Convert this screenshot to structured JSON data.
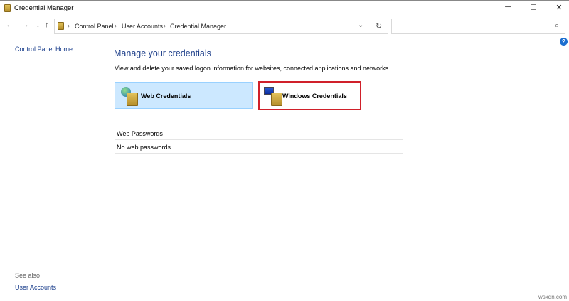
{
  "window": {
    "title": "Credential Manager",
    "minimize": "─",
    "maximize": "☐",
    "close": "✕"
  },
  "nav": {
    "back": "←",
    "forward": "→",
    "recent": "⌄",
    "up": "↑",
    "refresh": "↻",
    "dropdown": "⌄",
    "search_icon": "⌕"
  },
  "breadcrumb": [
    "Control Panel",
    "User Accounts",
    "Credential Manager"
  ],
  "search": {
    "placeholder": ""
  },
  "sidebar": {
    "home": "Control Panel Home",
    "see_also": "See also",
    "user_accounts": "User Accounts"
  },
  "main": {
    "title": "Manage your credentials",
    "description": "View and delete your saved logon information for websites, connected applications and networks.",
    "web_tile": "Web Credentials",
    "windows_tile": "Windows Credentials",
    "section_header": "Web Passwords",
    "empty": "No web passwords."
  },
  "help": "?",
  "watermark": "wsxdn.com",
  "colors": {
    "selected_tile": "#cce8ff",
    "highlight_border": "#d0202a",
    "link": "#1a3e8c"
  }
}
